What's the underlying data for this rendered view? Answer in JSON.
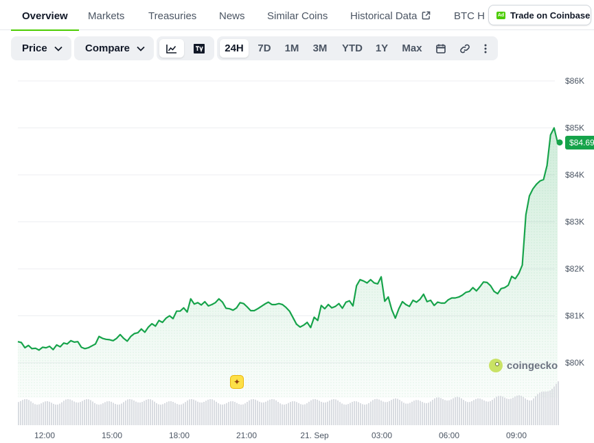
{
  "tabs": {
    "overview": "Overview",
    "markets": "Markets",
    "treasuries": "Treasuries",
    "news": "News",
    "similar_coins": "Similar Coins",
    "historical_data": "Historical Data",
    "btc_h": "BTC H"
  },
  "ad": {
    "badge": "Ad",
    "label": "Trade on Coinbase"
  },
  "toolbar": {
    "price_label": "Price",
    "compare_label": "Compare",
    "chart_type_icons": [
      "line-chart-icon",
      "tradingview-icon"
    ],
    "ranges": [
      "24H",
      "7D",
      "1M",
      "3M",
      "YTD",
      "1Y",
      "Max"
    ],
    "active_range": "24H",
    "extra_icons": [
      "calendar-icon",
      "link-icon",
      "more-vertical-icon"
    ]
  },
  "chart_data": {
    "type": "area",
    "y_ticks": [
      "$86K",
      "$85K",
      "$84K",
      "$83K",
      "$82K",
      "$81K",
      "$80K"
    ],
    "ylim": [
      79500,
      86000
    ],
    "x_ticks": [
      "12:00",
      "15:00",
      "18:00",
      "21:00",
      "21. Sep",
      "03:00",
      "06:00",
      "09:00"
    ],
    "current_price_label": "$84.69",
    "current_price": 84690,
    "line_color": "#16a34a",
    "fill_color": "#16a34a",
    "grid": true,
    "series": [
      {
        "values": [
          80450,
          80430,
          80320,
          80370,
          80300,
          80310,
          80270,
          80330,
          80320,
          80350,
          80280,
          80380,
          80340,
          80420,
          80400,
          80470,
          80440,
          80450,
          80330,
          80300,
          80320,
          80360,
          80400,
          80560,
          80520,
          80500,
          80490,
          80470,
          80520,
          80600,
          80520,
          80460,
          80560,
          80620,
          80640,
          80720,
          80650,
          80760,
          80830,
          80780,
          80900,
          80860,
          80950,
          81000,
          80940,
          81100,
          81100,
          81170,
          81080,
          81360,
          81250,
          81280,
          81230,
          81300,
          81210,
          81240,
          81280,
          81360,
          81290,
          81160,
          81150,
          81120,
          81170,
          81280,
          81260,
          81190,
          81110,
          81110,
          81150,
          81200,
          81250,
          81290,
          81240,
          81240,
          81260,
          81240,
          81180,
          81100,
          80960,
          80820,
          80760,
          80800,
          80860,
          80750,
          80970,
          80900,
          81220,
          81150,
          81240,
          81170,
          81200,
          81260,
          81160,
          81290,
          81320,
          81210,
          81640,
          81770,
          81740,
          81700,
          81770,
          81700,
          81680,
          81830,
          81310,
          81400,
          81130,
          80950,
          81150,
          81300,
          81240,
          81200,
          81330,
          81290,
          81350,
          81460,
          81300,
          81330,
          81220,
          81290,
          81270,
          81270,
          81340,
          81380,
          81380,
          81400,
          81440,
          81500,
          81520,
          81600,
          81530,
          81620,
          81720,
          81710,
          81640,
          81520,
          81470,
          81580,
          81600,
          81650,
          81840,
          81790,
          81900,
          82080,
          83150,
          83550,
          83700,
          83800,
          83870,
          83900,
          84200,
          84850,
          85000,
          84690
        ]
      }
    ]
  },
  "watermark": "coingecko",
  "event_marker_icon": "sparkle-icon"
}
